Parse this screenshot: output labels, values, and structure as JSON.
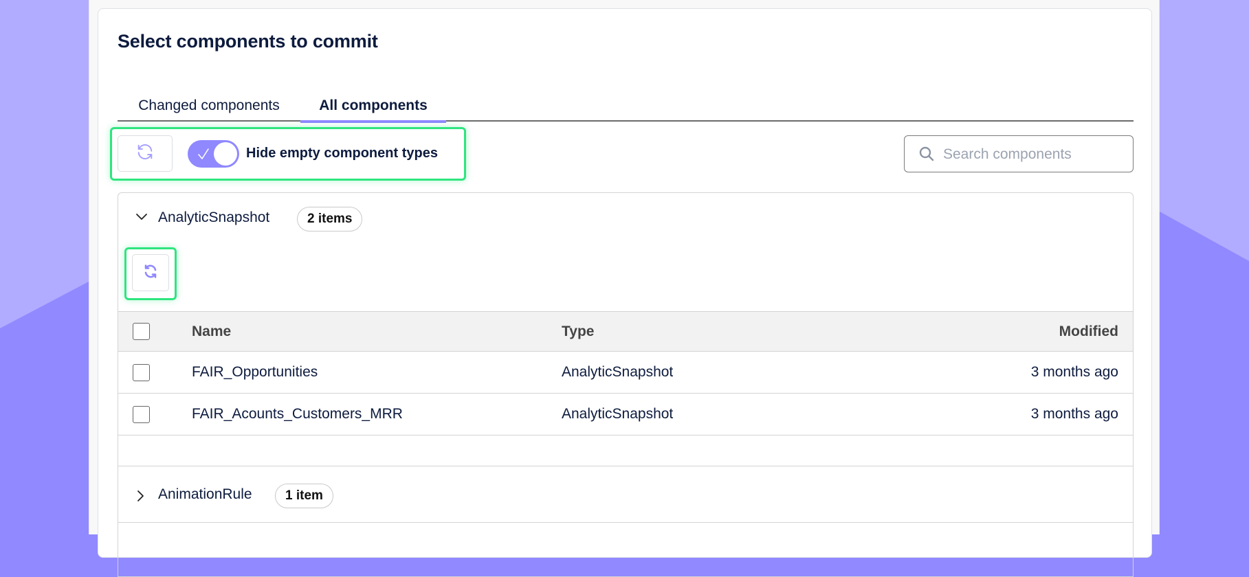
{
  "colors": {
    "accent": "#8f88ff",
    "highlight": "#2ee57f",
    "bg_light": "#b1acff",
    "bg_dark": "#9189ff",
    "text": "#0d1b3e"
  },
  "page": {
    "title": "Select components to commit"
  },
  "tabs": [
    {
      "label": "Changed components",
      "active": false
    },
    {
      "label": "All components",
      "active": true
    }
  ],
  "toolbar": {
    "refresh_icon": "refresh-icon",
    "toggle": {
      "label": "Hide empty component types",
      "checked": true,
      "icon": "check-icon"
    },
    "search": {
      "placeholder": "Search components",
      "value": "",
      "icon": "search-icon"
    }
  },
  "groups": [
    {
      "name": "AnalyticSnapshot",
      "badge": "2 items",
      "expanded": true,
      "expand_icon": "chevron-down-icon",
      "refresh_icon": "refresh-icon",
      "columns": [
        "Name",
        "Type",
        "Modified"
      ],
      "rows": [
        {
          "name": "FAIR_Opportunities",
          "type": "AnalyticSnapshot",
          "modified": "3 months ago",
          "checked": false
        },
        {
          "name": "FAIR_Acounts_Customers_MRR",
          "type": "AnalyticSnapshot",
          "modified": "3 months ago",
          "checked": false
        }
      ]
    },
    {
      "name": "AnimationRule",
      "badge": "1 item",
      "expanded": false,
      "expand_icon": "chevron-right-icon"
    }
  ]
}
